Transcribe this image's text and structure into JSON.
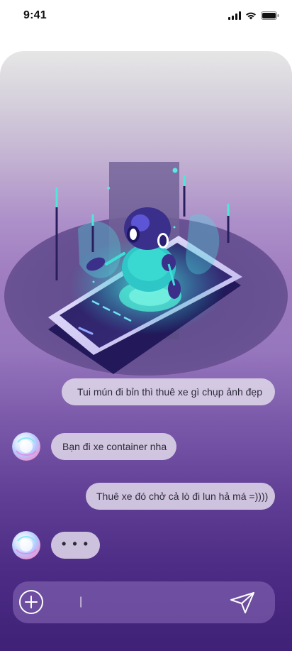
{
  "status_bar": {
    "time": "9:41",
    "icons": [
      "signal-icon",
      "wifi-icon",
      "battery-icon"
    ]
  },
  "chat": {
    "messages": [
      {
        "from": "user",
        "text": "Tui mún đi bỉn thì thuê xe gì chụp ảnh đẹp"
      },
      {
        "from": "bot",
        "text": "Bạn đi xe container nha"
      },
      {
        "from": "user",
        "text": "Thuê xe đó chở cả lò đi lun hả má =))))"
      }
    ],
    "typing_indicator": "• • •"
  },
  "composer": {
    "placeholder": "|",
    "icons": {
      "add": "plus-circle-icon",
      "send": "send-icon"
    }
  },
  "illustration": {
    "subject": "robot-on-phone-illustration"
  },
  "colors": {
    "bubble": "#ded6e8",
    "bubble_text": "#2c2a3a",
    "gradient_top": "#e6e6e6",
    "gradient_bottom": "#3f2177",
    "accent_cyan": "#3ee0d6"
  }
}
